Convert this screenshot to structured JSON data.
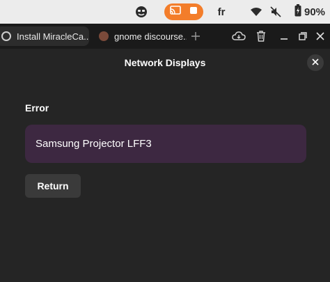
{
  "top_panel": {
    "language": "fr",
    "battery_percent": "90%",
    "icons": [
      "face-icon",
      "cast-icon",
      "stop-icon",
      "wifi-icon",
      "mute-icon",
      "battery-icon"
    ],
    "cast_color": "#f37d2a"
  },
  "tabs": [
    {
      "label": "Install MiracleCa...",
      "icon": "settings-icon"
    },
    {
      "label": "gnome discourse...",
      "icon": "brave-lion-icon"
    }
  ],
  "tab_bar_icons": [
    "new-tab-icon",
    "cloud-icon",
    "trash-icon",
    "minimize-icon",
    "maximize-icon",
    "close-icon"
  ],
  "dialog": {
    "title": "Network Displays",
    "error_label": "Error",
    "device_name": "Samsung Projector LFF3",
    "return_label": "Return",
    "highlight_color": "#3d2841"
  }
}
